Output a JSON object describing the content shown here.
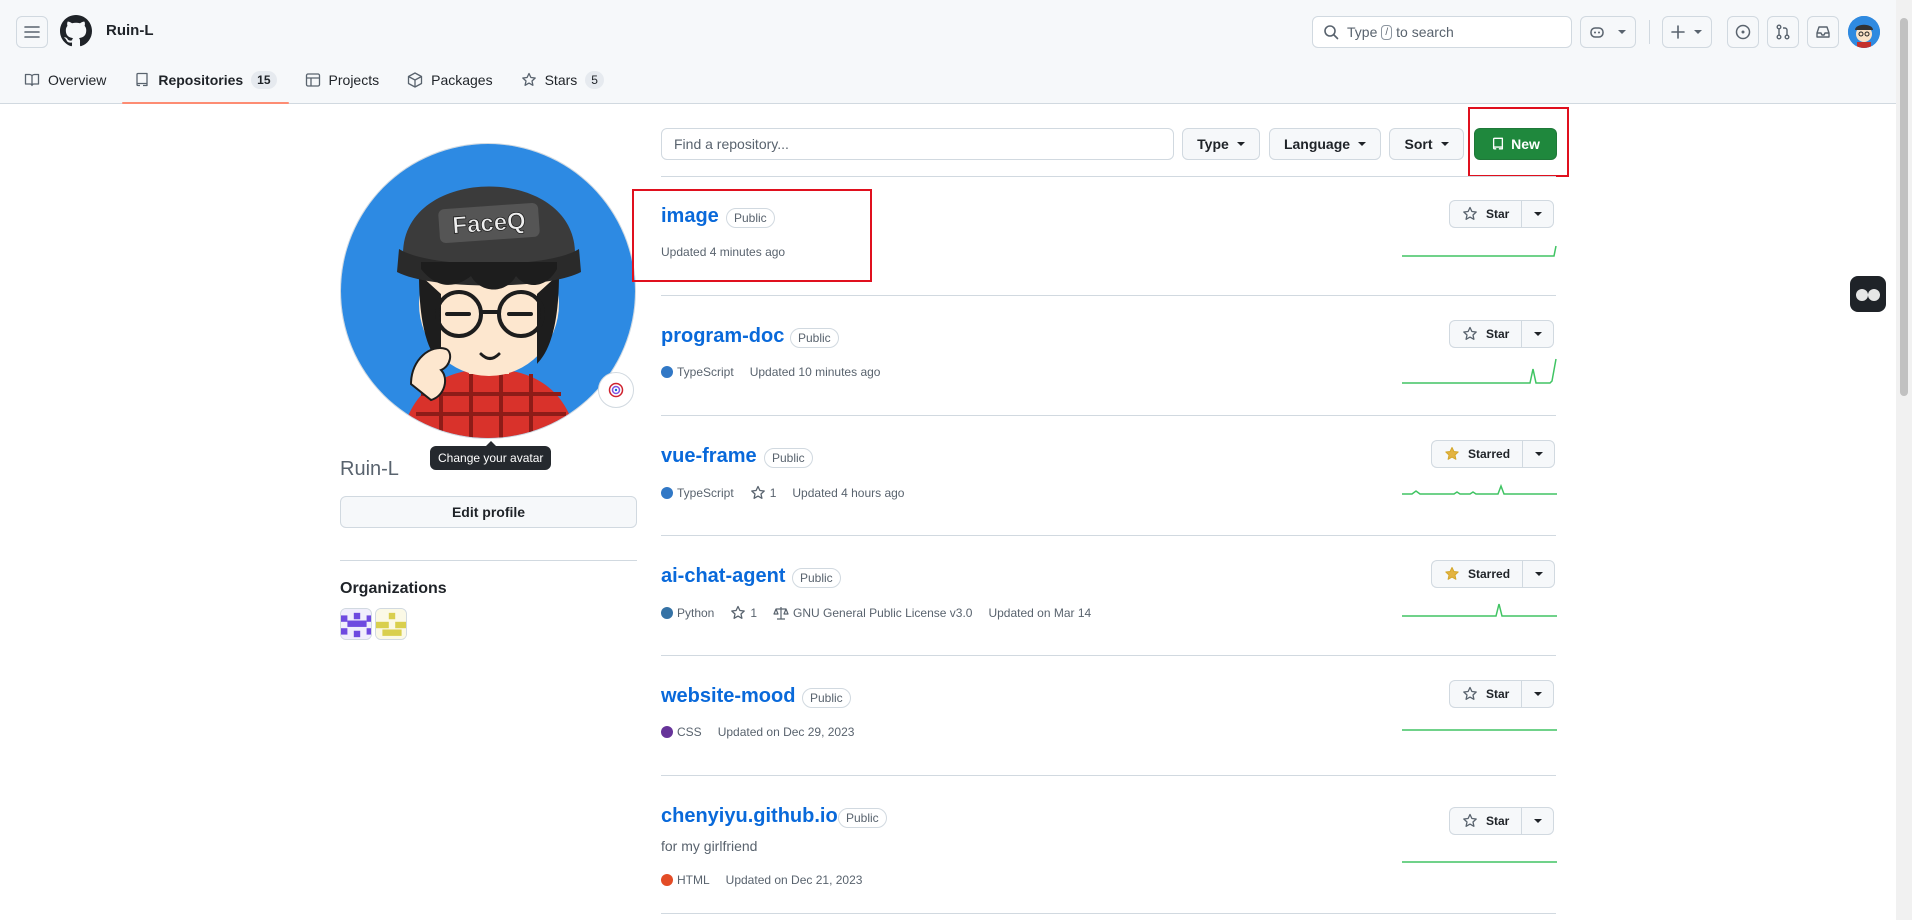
{
  "header": {
    "username": "Ruin-L",
    "search_prefix": "Type",
    "search_key": "/",
    "search_suffix": "to search"
  },
  "tabs": [
    {
      "label": "Overview",
      "icon": "book-icon"
    },
    {
      "label": "Repositories",
      "count": "15",
      "icon": "repo-icon",
      "selected": true
    },
    {
      "label": "Projects",
      "icon": "table-icon"
    },
    {
      "label": "Packages",
      "icon": "package-icon"
    },
    {
      "label": "Stars",
      "count": "5",
      "icon": "star-icon"
    }
  ],
  "profile": {
    "avatar_text": "FaceQ",
    "avatar_tooltip": "Change your avatar",
    "name": "Ruin-L",
    "edit_profile_label": "Edit profile",
    "organizations_title": "Organizations"
  },
  "filter": {
    "search_placeholder": "Find a repository...",
    "type_label": "Type",
    "language_label": "Language",
    "sort_label": "Sort",
    "new_label": "New"
  },
  "colors": {
    "accent_link": "#0969da",
    "new_button": "#1f883d",
    "highlight_box": "#e0101e",
    "typescript": "#3178c6",
    "python": "#3572A5",
    "css": "#663399",
    "html": "#e34c26",
    "sparkline": "#40c463"
  },
  "repos": [
    {
      "name": "image",
      "visibility": "Public",
      "updated": "Updated 4 minutes ago",
      "star_label": "Star"
    },
    {
      "name": "program-doc",
      "visibility": "Public",
      "language": "TypeScript",
      "updated": "Updated 10 minutes ago",
      "star_label": "Star"
    },
    {
      "name": "vue-frame",
      "visibility": "Public",
      "language": "TypeScript",
      "stars": "1",
      "updated": "Updated 4 hours ago",
      "star_label": "Starred"
    },
    {
      "name": "ai-chat-agent",
      "visibility": "Public",
      "language": "Python",
      "stars": "1",
      "license": "GNU General Public License v3.0",
      "updated": "Updated on Mar 14",
      "star_label": "Starred"
    },
    {
      "name": "website-mood",
      "visibility": "Public",
      "language": "CSS",
      "updated": "Updated on Dec 29, 2023",
      "star_label": "Star"
    },
    {
      "name": "chenyiyu.github.io",
      "visibility": "Public",
      "description": "for my girlfriend",
      "language": "HTML",
      "updated": "Updated on Dec 21, 2023",
      "star_label": "Star"
    }
  ]
}
